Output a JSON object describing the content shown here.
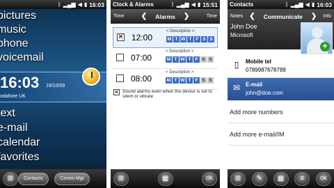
{
  "phone1": {
    "status_time": "16:03",
    "menu_top": [
      "pictures",
      "music",
      "phone",
      "voicemail"
    ],
    "clock_time": "16:03",
    "date": "19/10/09",
    "operator": "odafone UK",
    "menu_bottom": [
      "text",
      "e-mail",
      "calendar",
      "favorites"
    ],
    "contacts_label": "Contacts",
    "commmgr_label": "Comm Mgr"
  },
  "phone2": {
    "status_title": "Clock & Alarms",
    "status_time": "15:51",
    "left_tab": "Time",
    "title": "Alarms",
    "right_tab": "Time",
    "desc_label": "< Description >",
    "alarms": [
      {
        "time": "12:00",
        "checked": true
      },
      {
        "time": "07:00",
        "checked": false
      },
      {
        "time": "08:00",
        "checked": false
      }
    ],
    "days": [
      "M",
      "T",
      "W",
      "T",
      "F",
      "S",
      "S"
    ],
    "sound_text": "Sound alarms even when the device is set to silent or vibrate",
    "ok_label": "OK"
  },
  "phone3": {
    "status_title": "Contacts",
    "status_time": "16:03",
    "left_tab": "Notes",
    "title": "Communicate",
    "right_tab": "Info",
    "name": "John Doe",
    "company": "Microsoft",
    "mobile_label": "Mobile tel",
    "mobile_value": "0789987678789",
    "email_label": "E-mail",
    "email_value": "john@doe.com",
    "add_numbers": "Add more numbers",
    "add_email": "Add more e-mail/IM",
    "ok_label": "OK"
  },
  "colors": {
    "accent": "#3d6fc2",
    "selection": "#2a4f91"
  }
}
